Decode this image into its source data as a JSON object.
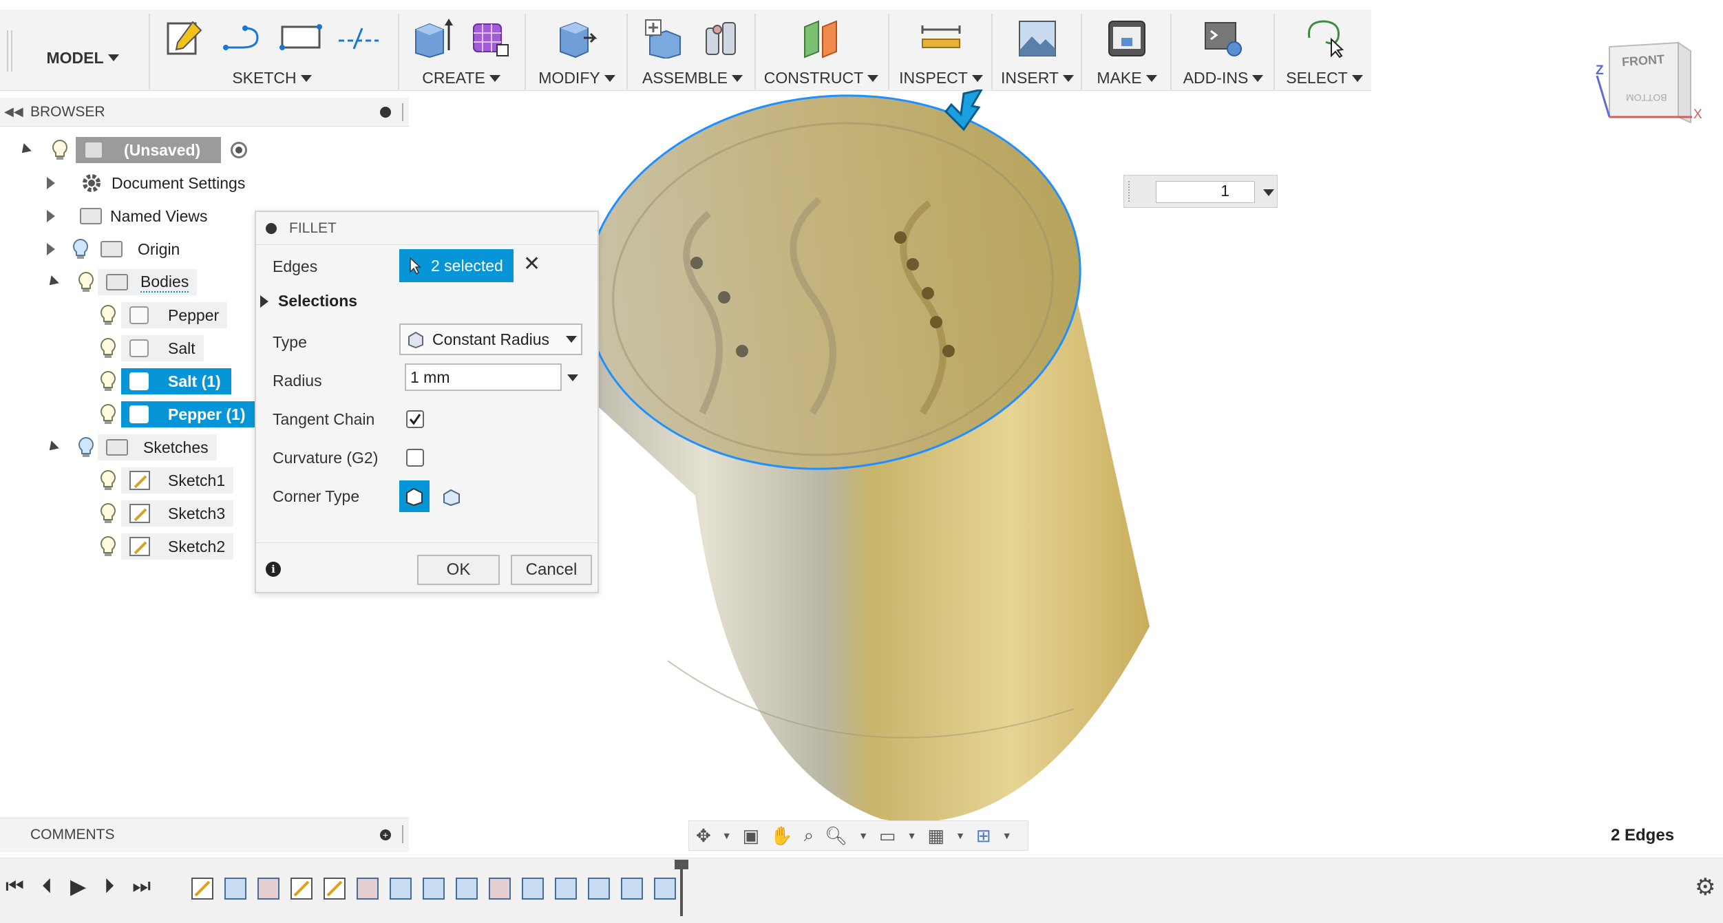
{
  "toolbar": {
    "workspace": "MODEL",
    "groups": [
      {
        "label": "SKETCH"
      },
      {
        "label": "CREATE"
      },
      {
        "label": "MODIFY"
      },
      {
        "label": "ASSEMBLE"
      },
      {
        "label": "CONSTRUCT"
      },
      {
        "label": "INSPECT"
      },
      {
        "label": "INSERT"
      },
      {
        "label": "MAKE"
      },
      {
        "label": "ADD-INS"
      },
      {
        "label": "SELECT"
      }
    ]
  },
  "browser": {
    "title": "BROWSER",
    "root": "(Unsaved)",
    "items": [
      {
        "label": "Document Settings"
      },
      {
        "label": "Named Views"
      },
      {
        "label": "Origin"
      },
      {
        "label": "Bodies"
      },
      {
        "label": "Pepper"
      },
      {
        "label": "Salt"
      },
      {
        "label": "Salt (1)"
      },
      {
        "label": "Pepper (1)"
      },
      {
        "label": "Sketches"
      },
      {
        "label": "Sketch1"
      },
      {
        "label": "Sketch3"
      },
      {
        "label": "Sketch2"
      }
    ]
  },
  "fillet": {
    "title": "FILLET",
    "edges_label": "Edges",
    "edges_value": "2 selected",
    "selections_label": "Selections",
    "type_label": "Type",
    "type_value": "Constant Radius",
    "radius_label": "Radius",
    "radius_value": "1 mm",
    "tangent_label": "Tangent Chain",
    "tangent_checked": true,
    "curvature_label": "Curvature (G2)",
    "curvature_checked": false,
    "corner_label": "Corner Type",
    "ok": "OK",
    "cancel": "Cancel"
  },
  "viewport": {
    "value_input": "1",
    "status": "2 Edges",
    "viewcube_front": "FRONT",
    "viewcube_bottom": "BOTTOM",
    "axis_z": "Z",
    "axis_x": "X"
  },
  "comments": {
    "title": "COMMENTS"
  },
  "colors": {
    "accent": "#0696d7",
    "body_gold": "#cbb565",
    "body_silver": "#b9b6a4",
    "selection_edge": "#1e90ff"
  }
}
